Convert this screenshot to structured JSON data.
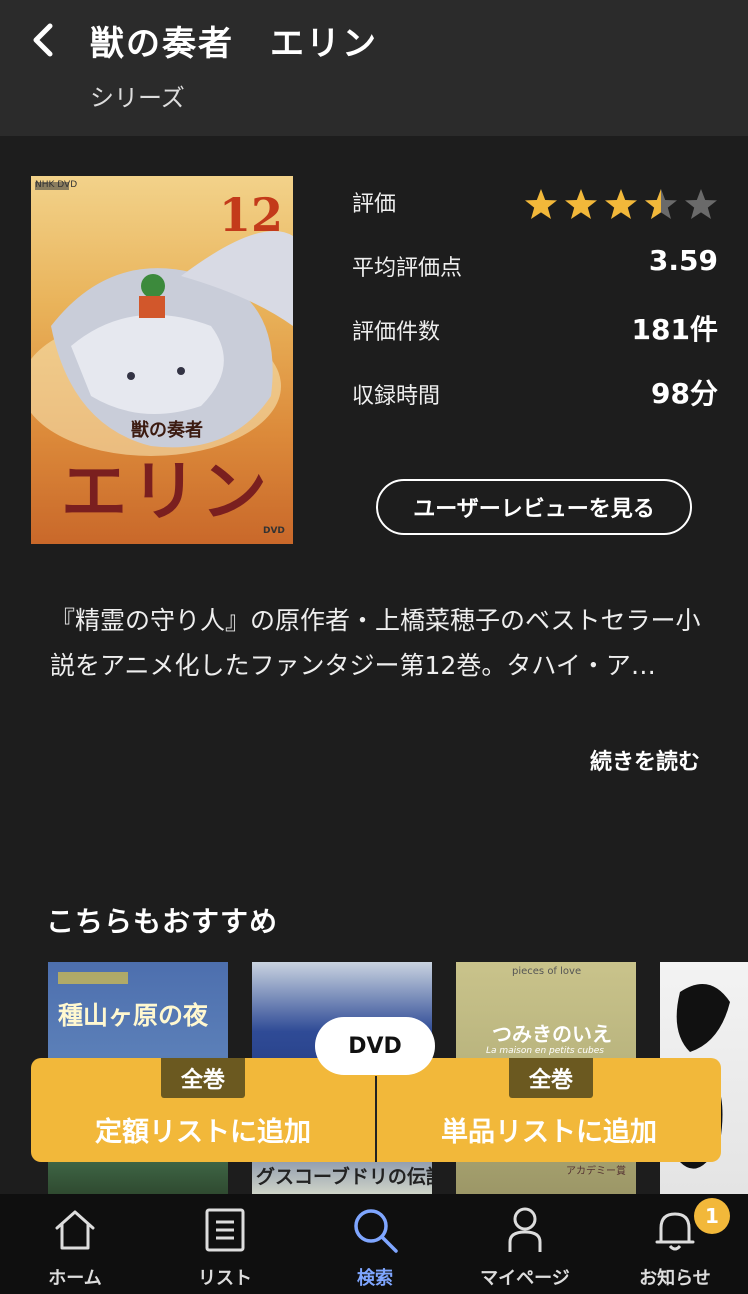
{
  "header": {
    "title": "獣の奏者　エリン",
    "subtitle": "シリーズ"
  },
  "cover": {
    "brand": "NHK DVD",
    "volume": "12",
    "series_small": "獣の奏者",
    "series_large": "エリン",
    "label": "DVD"
  },
  "stats": {
    "rating_label": "評価",
    "rating_stars": 3.5,
    "average_label": "平均評価点",
    "average_value": "3.59",
    "count_label": "評価件数",
    "count_value": "181件",
    "runtime_label": "収録時間",
    "runtime_value": "98分"
  },
  "review_button": "ユーザーレビューを見る",
  "description": "『精霊の守り人』の原作者・上橋菜穂子のベストセラー小説をアニメ化したファンタジー第12巻。タハイ・ア…",
  "read_more": "続きを読む",
  "recommendations": {
    "title": "こちらもおすすめ",
    "items": [
      {
        "title": "種山ヶ原の夜",
        "bottom": ""
      },
      {
        "title": "",
        "bottom": "グスコーブドリの伝記"
      },
      {
        "title": "つみきのいえ",
        "subtitle": "La maison en petits cubes",
        "top": "pieces of love",
        "bottom": "アカデミー賞"
      },
      {
        "title": ""
      }
    ]
  },
  "action_bar": {
    "format": "DVD",
    "left": {
      "badge": "全巻",
      "label": "定額リストに追加"
    },
    "right": {
      "badge": "全巻",
      "label": "単品リストに追加"
    }
  },
  "tabbar": {
    "items": [
      {
        "label": "ホーム",
        "icon": "home-icon"
      },
      {
        "label": "リスト",
        "icon": "list-icon"
      },
      {
        "label": "検索",
        "icon": "search-icon",
        "active": true
      },
      {
        "label": "マイページ",
        "icon": "person-icon"
      },
      {
        "label": "お知らせ",
        "icon": "bell-icon"
      }
    ],
    "notification_count": "1"
  },
  "colors": {
    "accent": "#f2b83a",
    "star": "#f2b83a",
    "star_empty": "#6a6a6a",
    "active_tab": "#7fa6ff"
  }
}
